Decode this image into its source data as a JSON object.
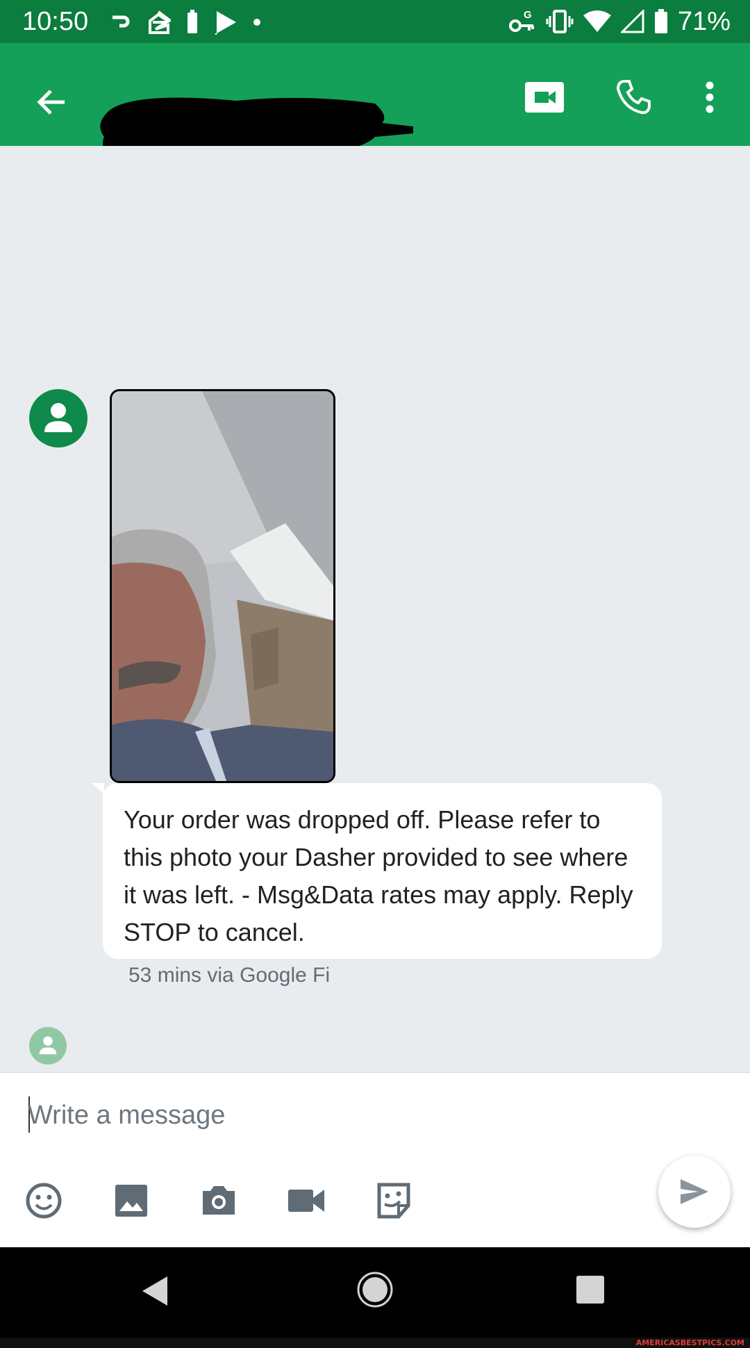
{
  "status_bar": {
    "time": "10:50",
    "battery_percent": "71%",
    "left_icons": [
      "app-notification-icon",
      "zillow-icon",
      "battery-saver-icon",
      "play-store-icon",
      "dot-icon"
    ],
    "right_icons": [
      "vpn-key-icon",
      "vibrate-icon",
      "wifi-icon",
      "cell-signal-icon",
      "battery-icon"
    ]
  },
  "app_bar": {
    "back_icon": "arrow-back-icon",
    "contact_name_redacted": true,
    "actions": [
      "video-call-icon",
      "phone-icon",
      "more-vert-icon"
    ]
  },
  "conversation": {
    "message": {
      "attachment": "photo",
      "text": "Your order was dropped off. Please refer to this photo your Dasher provided to see where it was left. - Msg&Data rates may apply. Reply STOP to cancel.",
      "meta": "53 mins via Google Fi"
    }
  },
  "compose": {
    "placeholder": "Write a message",
    "tools": [
      "emoji-icon",
      "gallery-icon",
      "camera-icon",
      "video-icon",
      "sticker-icon"
    ],
    "send_icon": "send-icon"
  },
  "nav_bar": {
    "buttons": [
      "back-triangle-icon",
      "home-circle-icon",
      "recents-square-icon"
    ]
  },
  "watermark": "AMERICASBESTPICS.COM",
  "colors": {
    "status_bar": "#0b7d3e",
    "app_bar": "#14a058",
    "background": "#e9ecef",
    "avatar": "#0f8a4a"
  }
}
